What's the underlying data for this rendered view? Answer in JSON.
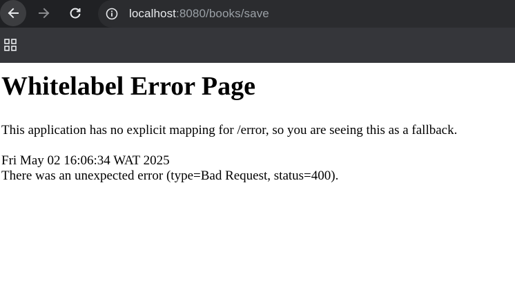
{
  "browser": {
    "url_host": "localhost",
    "url_rest": ":8080/books/save",
    "icons": {
      "back": "arrow-back-icon",
      "forward": "arrow-forward-icon",
      "reload": "reload-icon",
      "site_info": "info-icon",
      "apps": "apps-grid-icon"
    },
    "colors": {
      "toolbar_bg": "#202124",
      "omnibox_bg": "#2b2c2f",
      "bookmarks_bg": "#35363a"
    }
  },
  "page": {
    "title": "Whitelabel Error Page",
    "message": "This application has no explicit mapping for /error, so you are seeing this as a fallback.",
    "timestamp": "Fri May 02 16:06:34 WAT 2025",
    "error": "There was an unexpected error (type=Bad Request, status=400)."
  }
}
